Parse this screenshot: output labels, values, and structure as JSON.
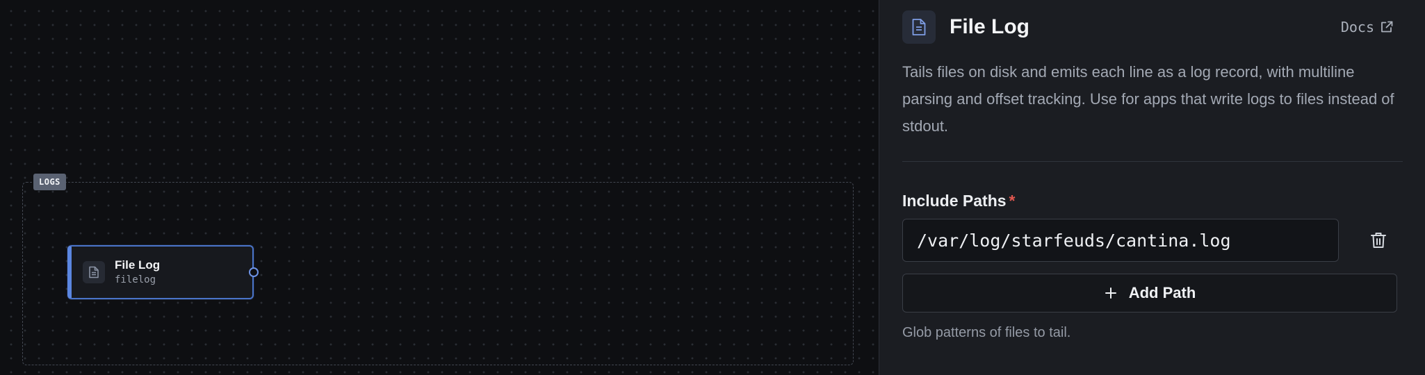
{
  "canvas": {
    "group_badge": "LOGS",
    "node": {
      "title": "File Log",
      "subtitle": "filelog",
      "icon": "document-icon"
    }
  },
  "panel": {
    "icon": "document-icon",
    "title": "File Log",
    "docs_label": "Docs",
    "docs_icon": "external-link-icon",
    "description": "Tails files on disk and emits each line as a log record, with multiline parsing and offset tracking. Use for apps that write logs to files instead of stdout.",
    "include_paths": {
      "label": "Include Paths",
      "required_mark": "*",
      "value": "/var/log/starfeuds/cantina.log",
      "delete_icon": "trash-icon",
      "add_label": "Add Path",
      "add_icon": "plus-icon",
      "help": "Glob patterns of files to tail."
    }
  },
  "colors": {
    "accent": "#5b86e0",
    "required": "#e0574f",
    "panel_bg": "#1b1d22",
    "canvas_bg": "#0e0f12"
  }
}
